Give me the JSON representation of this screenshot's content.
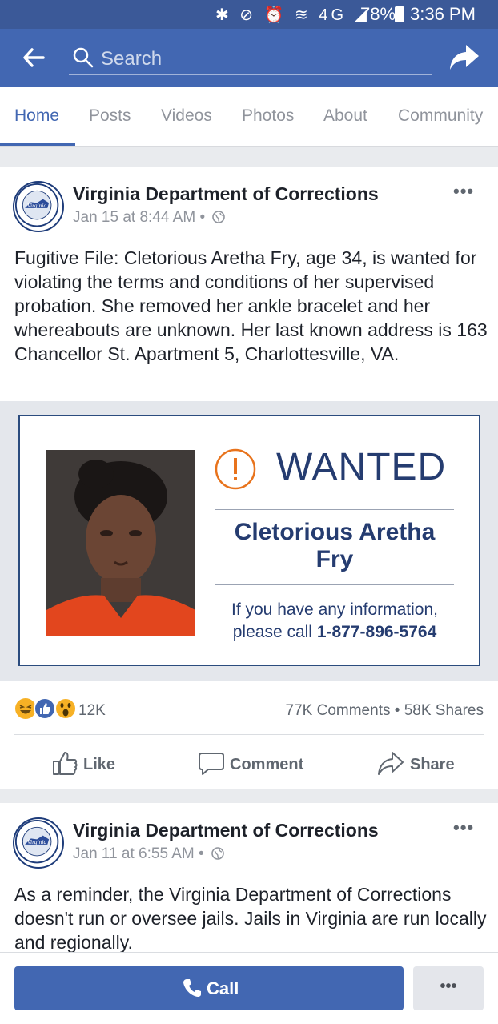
{
  "status_bar": {
    "icons": "✱ ⊘ ⏰ ≋ 4G ◢",
    "battery": "78%",
    "time": "3:36 PM"
  },
  "search": {
    "placeholder": "Search"
  },
  "tabs": [
    {
      "label": "Home",
      "active": true
    },
    {
      "label": "Posts"
    },
    {
      "label": "Videos"
    },
    {
      "label": "Photos"
    },
    {
      "label": "About"
    },
    {
      "label": "Community"
    }
  ],
  "posts": [
    {
      "page_name": "Virginia Department of Corrections",
      "timestamp": "Jan 15 at 8:44 AM",
      "text": "Fugitive File:  Cletorious Aretha Fry, age 34, is wanted for violating the terms and conditions of her supervised probation.  She removed her ankle bracelet and her whereabouts are unknown.  Her last known address is 163 Chancellor St. Apartment 5, Charlottesville, VA.",
      "image": {
        "headline": "WANTED",
        "name_line1": "Cletorious Aretha",
        "name_line2": "Fry",
        "info_text": "If you have any information,",
        "info_prefix": "please call",
        "phone": "1-877-896-5764"
      },
      "reaction_count": "12K",
      "comments": "77K Comments",
      "shares": "58K Shares",
      "actions": {
        "like": "Like",
        "comment": "Comment",
        "share": "Share"
      }
    },
    {
      "page_name": "Virginia Department of Corrections",
      "timestamp": "Jan 11 at 6:55 AM",
      "text": "As a reminder, the Virginia Department of Corrections doesn't run or oversee jails. Jails in Virginia are run locally and regionally."
    }
  ],
  "bottom_bar": {
    "call_label": "Call",
    "more_label": "•••"
  },
  "colors": {
    "facebook_blue": "#4267b2",
    "status_blue": "#3b5998",
    "poster_navy": "#253c70",
    "warning_orange": "#e8731c"
  }
}
